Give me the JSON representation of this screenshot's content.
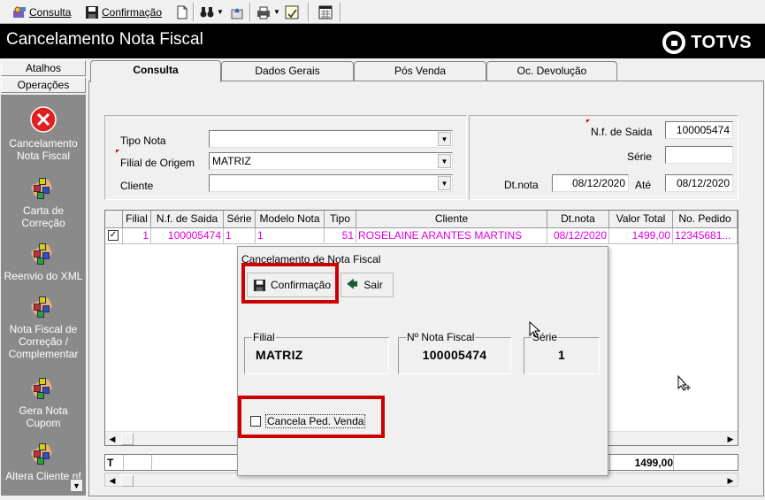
{
  "toolbar": {
    "consulta_label": "Consulta",
    "confirmacao_label": "Confirmação"
  },
  "window": {
    "title": "Cancelamento Nota Fiscal",
    "brand": "TOTVS"
  },
  "sidebar": {
    "atalhos_label": "Atalhos",
    "operacoes_label": "Operações",
    "items": [
      {
        "label": "Cancelamento Nota Fiscal",
        "icon": "cancel-icon"
      },
      {
        "label": "Carta de Correção",
        "icon": "boxes-icon"
      },
      {
        "label": "Reenvio do XML",
        "icon": "boxes-icon"
      },
      {
        "label": "Nota Fiscal de Correção / Complementar",
        "icon": "boxes-icon"
      },
      {
        "label": "Gera Nota Cupom",
        "icon": "boxes-icon"
      },
      {
        "label": "Altera Cliente nf",
        "icon": "boxes-icon"
      }
    ]
  },
  "tabs": [
    {
      "label": "Consulta",
      "active": true
    },
    {
      "label": "Dados Gerais",
      "active": false
    },
    {
      "label": "Pós Venda",
      "active": false
    },
    {
      "label": "Oc. Devolução",
      "active": false
    }
  ],
  "filters": {
    "tipo_nota_label": "Tipo Nota",
    "tipo_nota_value": "",
    "filial_origem_label": "Filial de Origem",
    "filial_origem_value": "MATRIZ",
    "cliente_label": "Cliente",
    "cliente_value": "",
    "nf_saida_label": "N.f. de Saida",
    "nf_saida_value": "100005474",
    "serie_label": "Série",
    "serie_value": "",
    "dt_nota_label": "Dt.nota",
    "dt_nota_value": "08/12/2020",
    "ate_label": "Até",
    "ate_value": "08/12/2020"
  },
  "grid": {
    "columns": [
      "Filial",
      "N.f. de Saida",
      "Série",
      "Modelo Nota",
      "Tipo",
      "Cliente",
      "Dt.nota",
      "Valor Total",
      "No. Pedido"
    ],
    "rows": [
      {
        "checked": true,
        "cells": [
          "1",
          "100005474",
          "1",
          "1",
          "51",
          "ROSELAINE ARANTES MARTINS",
          "08/12/2020",
          "1499,00",
          "12345681..."
        ]
      }
    ],
    "row_text_color": "#e000e0",
    "totals_label": "T",
    "total_value": "1499,00"
  },
  "dialog": {
    "title": "Cancelamento de Nota Fiscal",
    "confirm_label": "Confirmação",
    "exit_label": "Sair",
    "filial_caption": "Filial",
    "filial_value": "MATRIZ",
    "nf_caption": "Nº Nota Fiscal",
    "nf_value": "100005474",
    "serie_caption": "Série",
    "serie_value": "1",
    "cancel_checkbox_label": "Cancela Ped. Venda",
    "cancel_checkbox_checked": false,
    "highlight_color": "#cc0000"
  }
}
